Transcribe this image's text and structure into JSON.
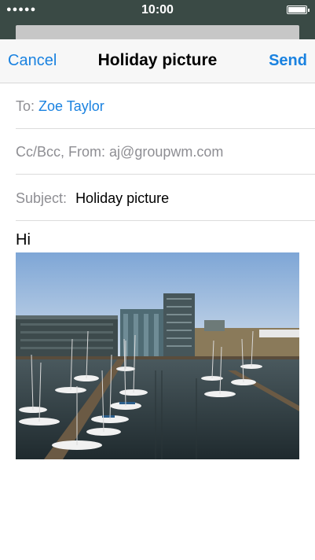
{
  "status_bar": {
    "signal": "●●●●●",
    "time": "10:00",
    "battery_icon": "battery-icon"
  },
  "nav": {
    "cancel_label": "Cancel",
    "title": "Holiday picture",
    "send_label": "Send"
  },
  "fields": {
    "to_label": "To:",
    "to_value": "Zoe Taylor",
    "ccbcc_label": "Cc/Bcc, From:",
    "from_value": "aj@groupwm.com",
    "subject_label": "Subject:",
    "subject_value": "Holiday picture"
  },
  "body": {
    "text": "Hi"
  },
  "attachment": {
    "kind": "photo",
    "subject": "harbor-marina-with-sailboats-and-office-buildings"
  },
  "colors": {
    "accent": "#1a82e0",
    "status_bar_bg": "#3a4a45",
    "nav_bg": "#f7f7f7"
  }
}
